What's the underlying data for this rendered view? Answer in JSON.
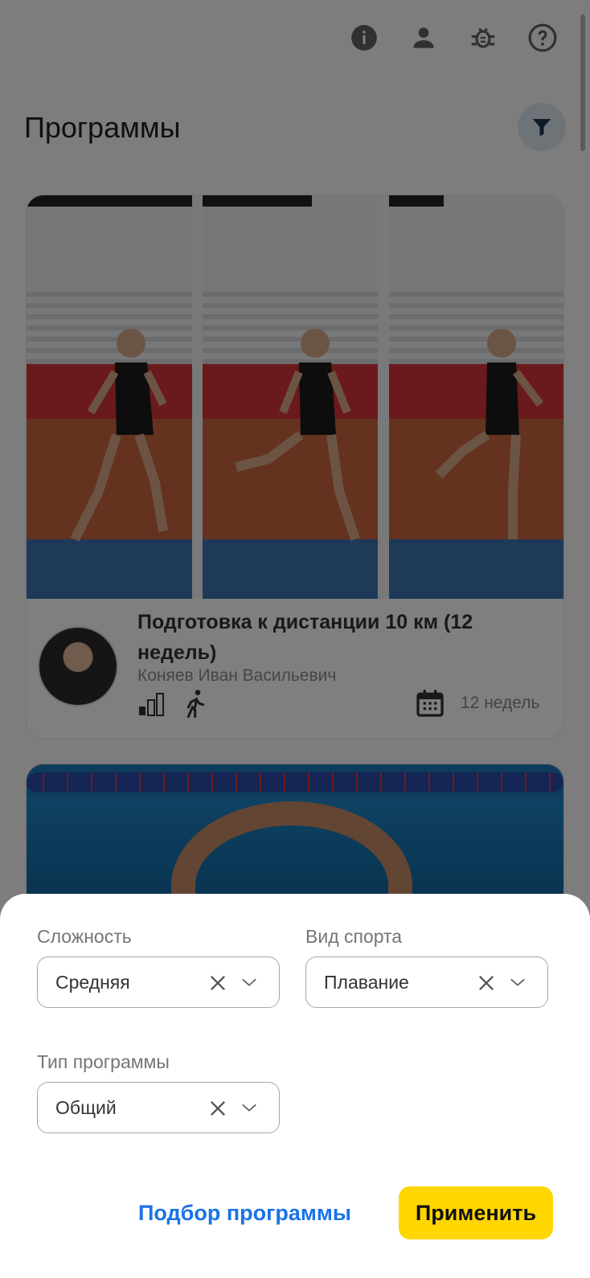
{
  "header": {
    "icons": [
      "info-icon",
      "user-icon",
      "bug-icon",
      "help-icon"
    ]
  },
  "page": {
    "title": "Программы",
    "filter_icon": "filter-icon"
  },
  "programs": [
    {
      "title": "Подготовка к дистанции 10 км (12 недель)",
      "coach": "Коняев Иван Васильевич",
      "duration": "12 недель",
      "icons": [
        "level-bars-icon",
        "running-icon",
        "calendar-icon"
      ]
    }
  ],
  "filters": {
    "difficulty": {
      "label": "Сложность",
      "value": "Средняя"
    },
    "sport": {
      "label": "Вид спорта",
      "value": "Плавание"
    },
    "program_type": {
      "label": "Тип программы",
      "value": "Общий"
    }
  },
  "actions": {
    "pick_program": "Подбор программы",
    "apply": "Применить"
  },
  "colors": {
    "accent_blue": "#1a73e8",
    "apply_yellow": "#ffd600",
    "overlay": "rgba(0,0,0,0.5)"
  }
}
